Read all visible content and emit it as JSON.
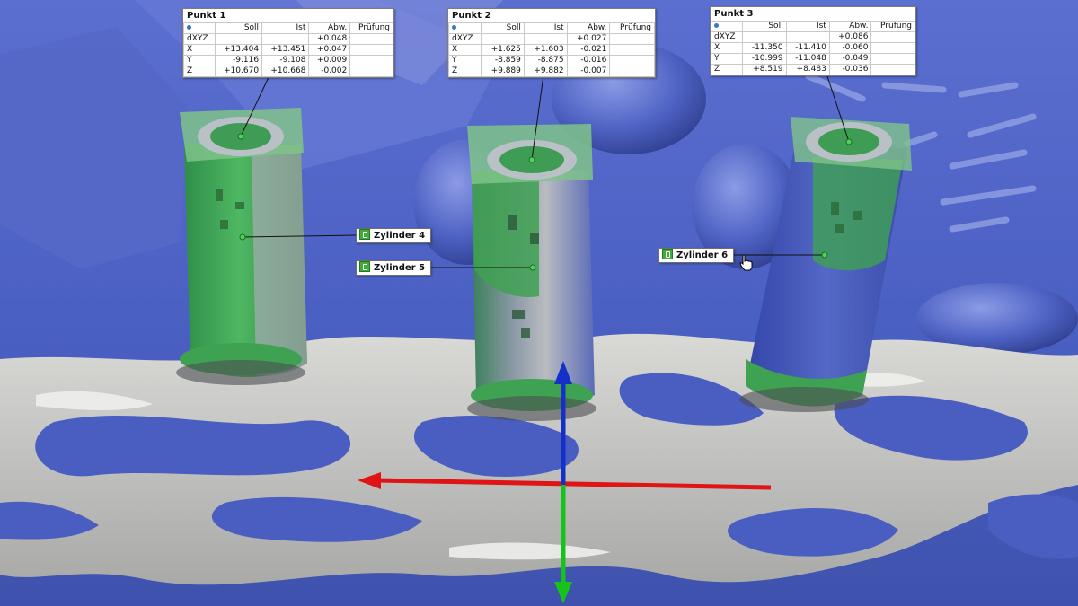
{
  "points": [
    {
      "title": "Punkt 1",
      "columns": [
        "Soll",
        "Ist",
        "Abw.",
        "Prüfung"
      ],
      "rows": [
        {
          "label": "dXYZ",
          "soll": "",
          "ist": "",
          "abw": "+0.048",
          "pruefung": ""
        },
        {
          "label": "X",
          "soll": "+13.404",
          "ist": "+13.451",
          "abw": "+0.047",
          "pruefung": ""
        },
        {
          "label": "Y",
          "soll": "-9.116",
          "ist": "-9.108",
          "abw": "+0.009",
          "pruefung": ""
        },
        {
          "label": "Z",
          "soll": "+10.670",
          "ist": "+10.668",
          "abw": "-0.002",
          "pruefung": ""
        }
      ]
    },
    {
      "title": "Punkt 2",
      "columns": [
        "Soll",
        "Ist",
        "Abw.",
        "Prüfung"
      ],
      "rows": [
        {
          "label": "dXYZ",
          "soll": "",
          "ist": "",
          "abw": "+0.027",
          "pruefung": ""
        },
        {
          "label": "X",
          "soll": "+1.625",
          "ist": "+1.603",
          "abw": "-0.021",
          "pruefung": ""
        },
        {
          "label": "Y",
          "soll": "-8.859",
          "ist": "-8.875",
          "abw": "-0.016",
          "pruefung": ""
        },
        {
          "label": "Z",
          "soll": "+9.889",
          "ist": "+9.882",
          "abw": "-0.007",
          "pruefung": ""
        }
      ]
    },
    {
      "title": "Punkt 3",
      "columns": [
        "Soll",
        "Ist",
        "Abw.",
        "Prüfung"
      ],
      "rows": [
        {
          "label": "dXYZ",
          "soll": "",
          "ist": "",
          "abw": "+0.086",
          "pruefung": ""
        },
        {
          "label": "X",
          "soll": "-11.350",
          "ist": "-11.410",
          "abw": "-0.060",
          "pruefung": ""
        },
        {
          "label": "Y",
          "soll": "-10.999",
          "ist": "-11.048",
          "abw": "-0.049",
          "pruefung": ""
        },
        {
          "label": "Z",
          "soll": "+8.519",
          "ist": "+8.483",
          "abw": "-0.036",
          "pruefung": ""
        }
      ]
    }
  ],
  "cylinders": [
    {
      "label": "Zylinder 4"
    },
    {
      "label": "Zylinder 5"
    },
    {
      "label": "Zylinder 6"
    }
  ],
  "colors": {
    "background_model": "#4f63c4",
    "scan_surface": "#c3c3c0",
    "cylinder_fit": "#3fa152",
    "axis_x": "#e01414",
    "axis_y": "#15c31b",
    "axis_z": "#1530c8",
    "label_icon": "#3fae3a"
  },
  "icons": {
    "label_icon": "cylinder-feature-icon",
    "cursor": "hand-pointer-icon"
  }
}
